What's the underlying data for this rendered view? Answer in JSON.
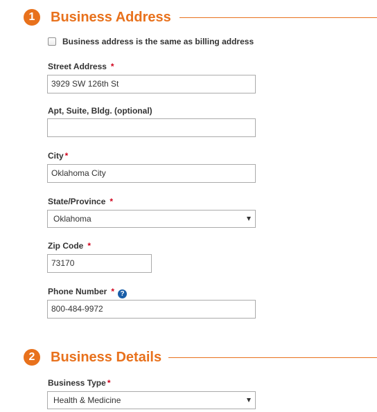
{
  "colors": {
    "accent": "#e8711c",
    "required": "#d0021b",
    "help": "#1a5ea8",
    "input_border": "#aaaaaa"
  },
  "section1": {
    "number": "1",
    "title": "Business Address",
    "same_as_billing": {
      "label": "Business address is the same as billing address",
      "checked": false
    },
    "fields": {
      "street": {
        "label": "Street Address",
        "required": "*",
        "value": "3929 SW 126th St"
      },
      "apt": {
        "label": "Apt, Suite, Bldg. (optional)",
        "value": ""
      },
      "city": {
        "label": "City",
        "required": "*",
        "value": "Oklahoma City"
      },
      "state": {
        "label": "State/Province",
        "required": "*",
        "value": "Oklahoma"
      },
      "zip": {
        "label": "Zip Code",
        "required": "*",
        "value": "73170"
      },
      "phone": {
        "label": "Phone Number",
        "required": "*",
        "value": "800-484-9972",
        "help_icon": "question-circle-icon",
        "help_glyph": "?"
      }
    }
  },
  "section2": {
    "number": "2",
    "title": "Business Details",
    "fields": {
      "business_type": {
        "label": "Business Type",
        "required": "*",
        "value": "Health & Medicine"
      }
    }
  }
}
